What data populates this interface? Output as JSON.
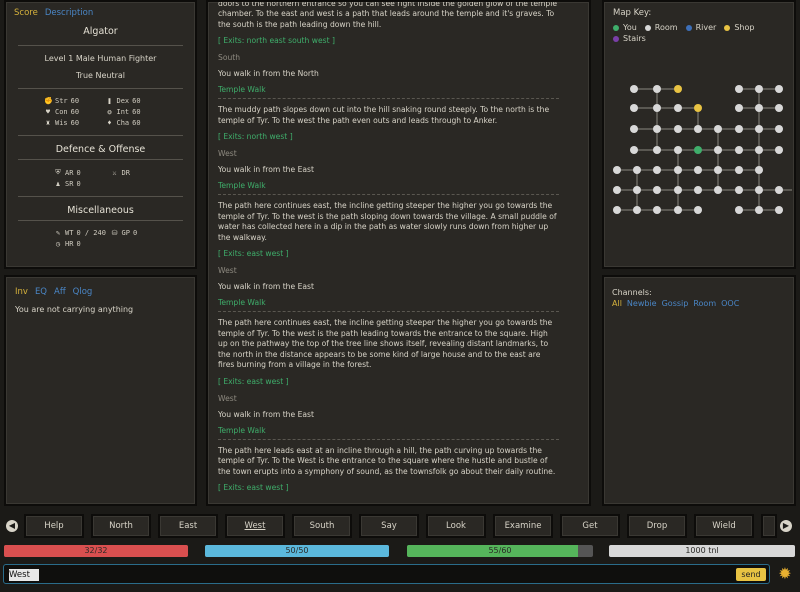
{
  "score": {
    "tabs": [
      {
        "label": "Score",
        "active": true
      },
      {
        "label": "Description",
        "active": false
      }
    ],
    "name": "Algator",
    "level_line": "Level 1 Male Human Fighter",
    "alignment": "True Neutral",
    "stats": [
      {
        "label": "Str",
        "value": "60",
        "icon": "fist-icon",
        "glyph": "✊"
      },
      {
        "label": "Dex",
        "value": "60",
        "icon": "book-icon",
        "glyph": "❚"
      },
      {
        "label": "Con",
        "value": "60",
        "icon": "heart-icon",
        "glyph": "♥"
      },
      {
        "label": "Int",
        "value": "60",
        "icon": "brain-icon",
        "glyph": "❂"
      },
      {
        "label": "Wis",
        "value": "60",
        "icon": "flask-icon",
        "glyph": "♜"
      },
      {
        "label": "Cha",
        "value": "60",
        "icon": "flame-icon",
        "glyph": "♦"
      }
    ],
    "defence_title": "Defence & Offense",
    "defence": [
      {
        "label": "AR",
        "value": "0",
        "icon": "shield-icon",
        "glyph": "⛨"
      },
      {
        "label": "DR",
        "value": "",
        "icon": "sword-icon",
        "glyph": "⚔"
      },
      {
        "label": "SR",
        "value": "0",
        "icon": "person-icon",
        "glyph": "♟"
      }
    ],
    "misc_title": "Miscellaneous",
    "misc": [
      {
        "label": "WT",
        "value": "0 / 240",
        "icon": "feather-icon",
        "glyph": "✎"
      },
      {
        "label": "GP",
        "value": "0",
        "icon": "coins-icon",
        "glyph": "⛁"
      },
      {
        "label": "HR",
        "value": "0",
        "icon": "clock-icon",
        "glyph": "◷"
      }
    ]
  },
  "inventory": {
    "tabs": [
      {
        "label": "Inv",
        "active": true
      },
      {
        "label": "EQ",
        "active": false
      },
      {
        "label": "Aff",
        "active": false
      },
      {
        "label": "Qlog",
        "active": false
      }
    ],
    "text": "You are not carrying anything"
  },
  "output": [
    {
      "kind": "room",
      "text": "doors to the northern entrance so you can see right inside the golden glow of the temple chamber. To the east and west is a path that leads around the temple and it's graves. To the south is the path leading down the hill."
    },
    {
      "kind": "exits",
      "text": "[ Exits: north east south west ]"
    },
    {
      "kind": "dir",
      "text": "South"
    },
    {
      "kind": "move",
      "text": "You walk in from the North"
    },
    {
      "kind": "title",
      "text": "Temple Walk"
    },
    {
      "kind": "room",
      "text": "The muddy path slopes down cut into the hill snaking round steeply. To the north is the temple of Tyr. To the west the path even outs and leads through to Anker."
    },
    {
      "kind": "exits",
      "text": "[ Exits: north west ]"
    },
    {
      "kind": "dir",
      "text": "West"
    },
    {
      "kind": "move",
      "text": "You walk in from the East"
    },
    {
      "kind": "title",
      "text": "Temple Walk"
    },
    {
      "kind": "room",
      "text": "The path here continues east, the incline getting steeper the higher you go towards the temple of Tyr. To the west is the path sloping down towards the village. A small puddle of water has collected here in a dip in the path as water slowly runs down from higher up the walkway."
    },
    {
      "kind": "exits",
      "text": "[ Exits: east west ]"
    },
    {
      "kind": "dir",
      "text": "West"
    },
    {
      "kind": "move",
      "text": "You walk in from the East"
    },
    {
      "kind": "title",
      "text": "Temple Walk"
    },
    {
      "kind": "room",
      "text": "The path here continues east, the incline getting steeper the higher you go towards the temple of Tyr. To the west is the path leading towards the entrance to the square. High up on the pathway the top of the tree line shows itself, revealing distant landmarks, to the north in the distance appears to be some kind of large house and to the east are fires burning from a village in the forest."
    },
    {
      "kind": "exits",
      "text": "[ Exits: east west ]"
    },
    {
      "kind": "dir",
      "text": "West"
    },
    {
      "kind": "move",
      "text": "You walk in from the East"
    },
    {
      "kind": "title",
      "text": "Temple Walk"
    },
    {
      "kind": "room",
      "text": "The path here leads east at an incline through a hill, the path curving up towards the temple of Tyr. To the West is the entrance to the square where the hustle and bustle of the town erupts into a symphony of sound, as the townsfolk go about their daily routine."
    },
    {
      "kind": "exits",
      "text": "[ Exits: east west ]"
    }
  ],
  "map": {
    "title": "Map Key:",
    "legend": [
      {
        "label": "You",
        "color": "#3fae6b"
      },
      {
        "label": "Room",
        "color": "#d8d8d8"
      },
      {
        "label": "River",
        "color": "#3d6fb8"
      },
      {
        "label": "Shop",
        "color": "#e8c343"
      },
      {
        "label": "Stairs",
        "color": "#7a3fa8"
      }
    ]
  },
  "channels": {
    "label": "Channels:",
    "tabs": [
      {
        "label": "All",
        "active": true
      },
      {
        "label": "Newbie",
        "active": false
      },
      {
        "label": "Gossip",
        "active": false
      },
      {
        "label": "Room",
        "active": false
      },
      {
        "label": "OOC",
        "active": false
      }
    ]
  },
  "commands": {
    "buttons": [
      "Help",
      "North",
      "East",
      "West",
      "South",
      "Say",
      "Look",
      "Examine",
      "Get",
      "Drop",
      "Wield"
    ],
    "active": "West"
  },
  "bars": [
    {
      "name": "hp",
      "label": "32/32",
      "fraction": 1.0,
      "color": "#d94f4f"
    },
    {
      "name": "mana",
      "label": "50/50",
      "fraction": 1.0,
      "color": "#5bb8dc"
    },
    {
      "name": "moves",
      "label": "55/60",
      "fraction": 0.917,
      "color": "#55b55b"
    },
    {
      "name": "tnl",
      "label": "1000 tnl",
      "fraction": 1.0,
      "color": "#d8d8d8"
    }
  ],
  "input": {
    "value": "West",
    "send_label": "send"
  }
}
